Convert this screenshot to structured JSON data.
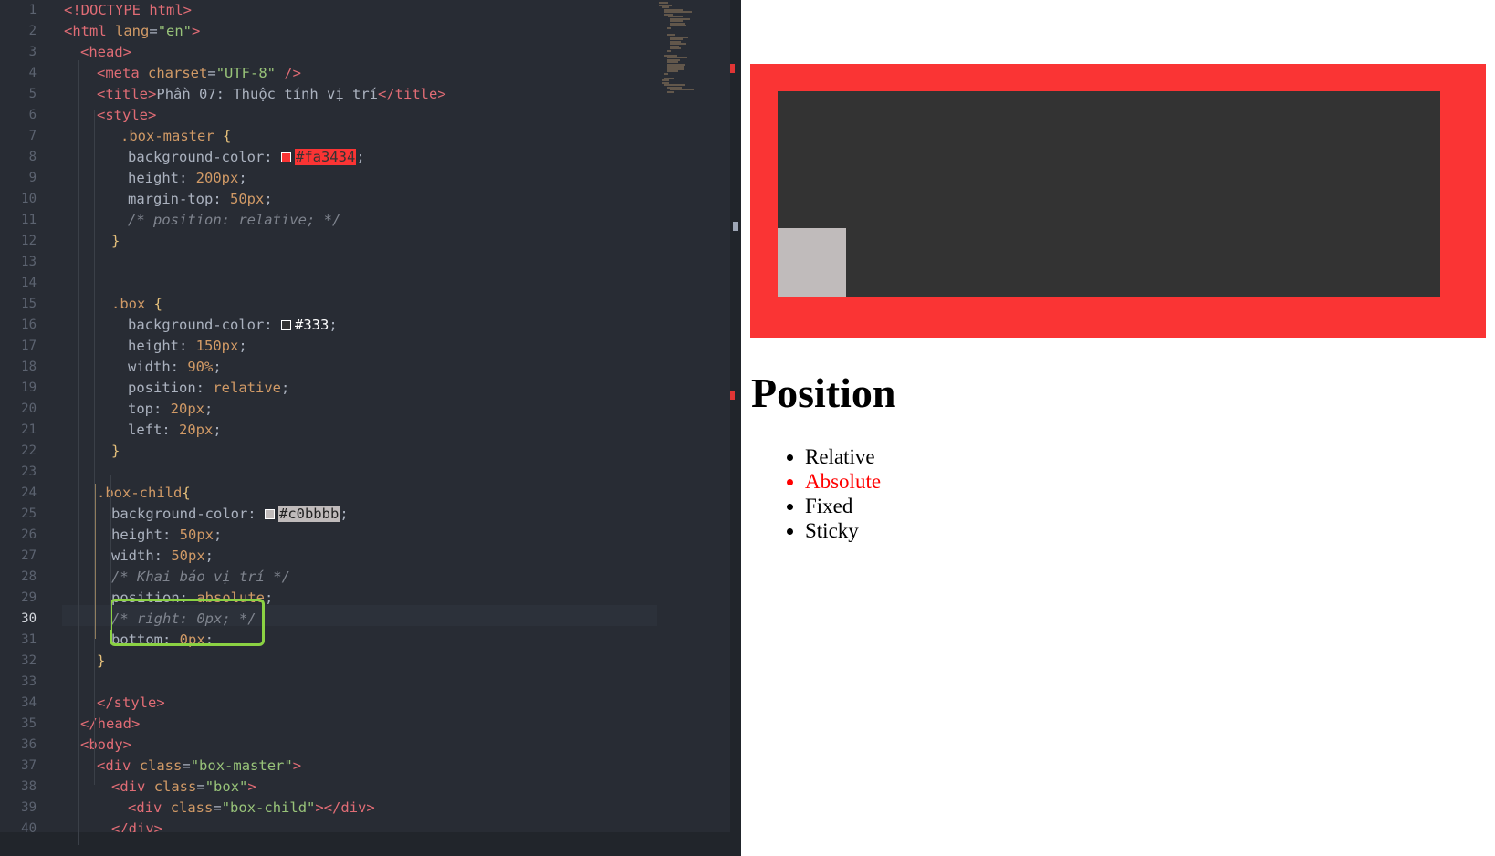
{
  "editor": {
    "active_line": "30",
    "line_numbers": [
      "1",
      "2",
      "3",
      "4",
      "5",
      "6",
      "7",
      "8",
      "9",
      "10",
      "11",
      "12",
      "13",
      "14",
      "15",
      "16",
      "17",
      "18",
      "19",
      "20",
      "21",
      "22",
      "23",
      "24",
      "25",
      "26",
      "27",
      "28",
      "29",
      "30",
      "31",
      "32",
      "33",
      "34",
      "35",
      "36",
      "37",
      "38",
      "39",
      "40"
    ],
    "lines": [
      [
        "<!",
        "DOCTYPE",
        " html>"
      ],
      [
        "<",
        "html",
        " ",
        "lang",
        "=",
        "\"en\"",
        ">"
      ],
      [
        "<",
        "head",
        ">"
      ],
      [
        "<",
        "meta",
        " ",
        "charset",
        "=",
        "\"UTF-8\"",
        " />"
      ],
      [
        "<",
        "title",
        ">",
        "Phần 07: Thuộc tính vị trí",
        "</",
        "title",
        ">"
      ],
      [
        "<",
        "style",
        ">"
      ],
      [
        ".box-master",
        " {"
      ],
      [
        "background-color: ",
        "#fa3434",
        ";"
      ],
      [
        "height: ",
        "200px",
        ";"
      ],
      [
        "margin-top: ",
        "50px",
        ";"
      ],
      [
        "/* position: relative; */"
      ],
      [
        "}"
      ],
      [],
      [],
      [
        ".box",
        " {"
      ],
      [
        "background-color: ",
        "#333",
        ";"
      ],
      [
        "height: ",
        "150px",
        ";"
      ],
      [
        "width: ",
        "90%",
        ";"
      ],
      [
        "position: ",
        "relative",
        ";"
      ],
      [
        "top: ",
        "20px",
        ";"
      ],
      [
        "left: ",
        "20px",
        ";"
      ],
      [
        "}"
      ],
      [],
      [
        ".box-child",
        "{"
      ],
      [
        "background-color: ",
        "#c0bbbb",
        ";"
      ],
      [
        "height: ",
        "50px",
        ";"
      ],
      [
        "width: ",
        "50px",
        ";"
      ],
      [
        "/* Khai báo vị trí */"
      ],
      [
        "position: ",
        "absolute",
        ";"
      ],
      [
        "/* right: 0px; */"
      ],
      [
        "bottom: ",
        "0px",
        ";"
      ],
      [
        "}"
      ],
      [],
      [
        "</",
        "style",
        ">"
      ],
      [
        "</",
        "head",
        ">"
      ],
      [
        "<",
        "body",
        ">"
      ],
      [
        "<",
        "div",
        " ",
        "class",
        "=",
        "\"box-master\"",
        ">"
      ],
      [
        "<",
        "div",
        " ",
        "class",
        "=",
        "\"box\"",
        ">"
      ],
      [
        "<",
        "div",
        " ",
        "class",
        "=",
        "\"box-child\"",
        "></",
        "div",
        ">"
      ],
      [
        "</",
        "div",
        ">"
      ]
    ]
  },
  "preview": {
    "title": "Position",
    "list_items": [
      "Relative",
      "Absolute",
      "Fixed",
      "Sticky"
    ],
    "highlight_item": "Absolute",
    "colors": {
      "box_master": "#fa3434",
      "box": "#333333",
      "box_child": "#c0bbbb",
      "highlight": "#ff0000"
    }
  }
}
